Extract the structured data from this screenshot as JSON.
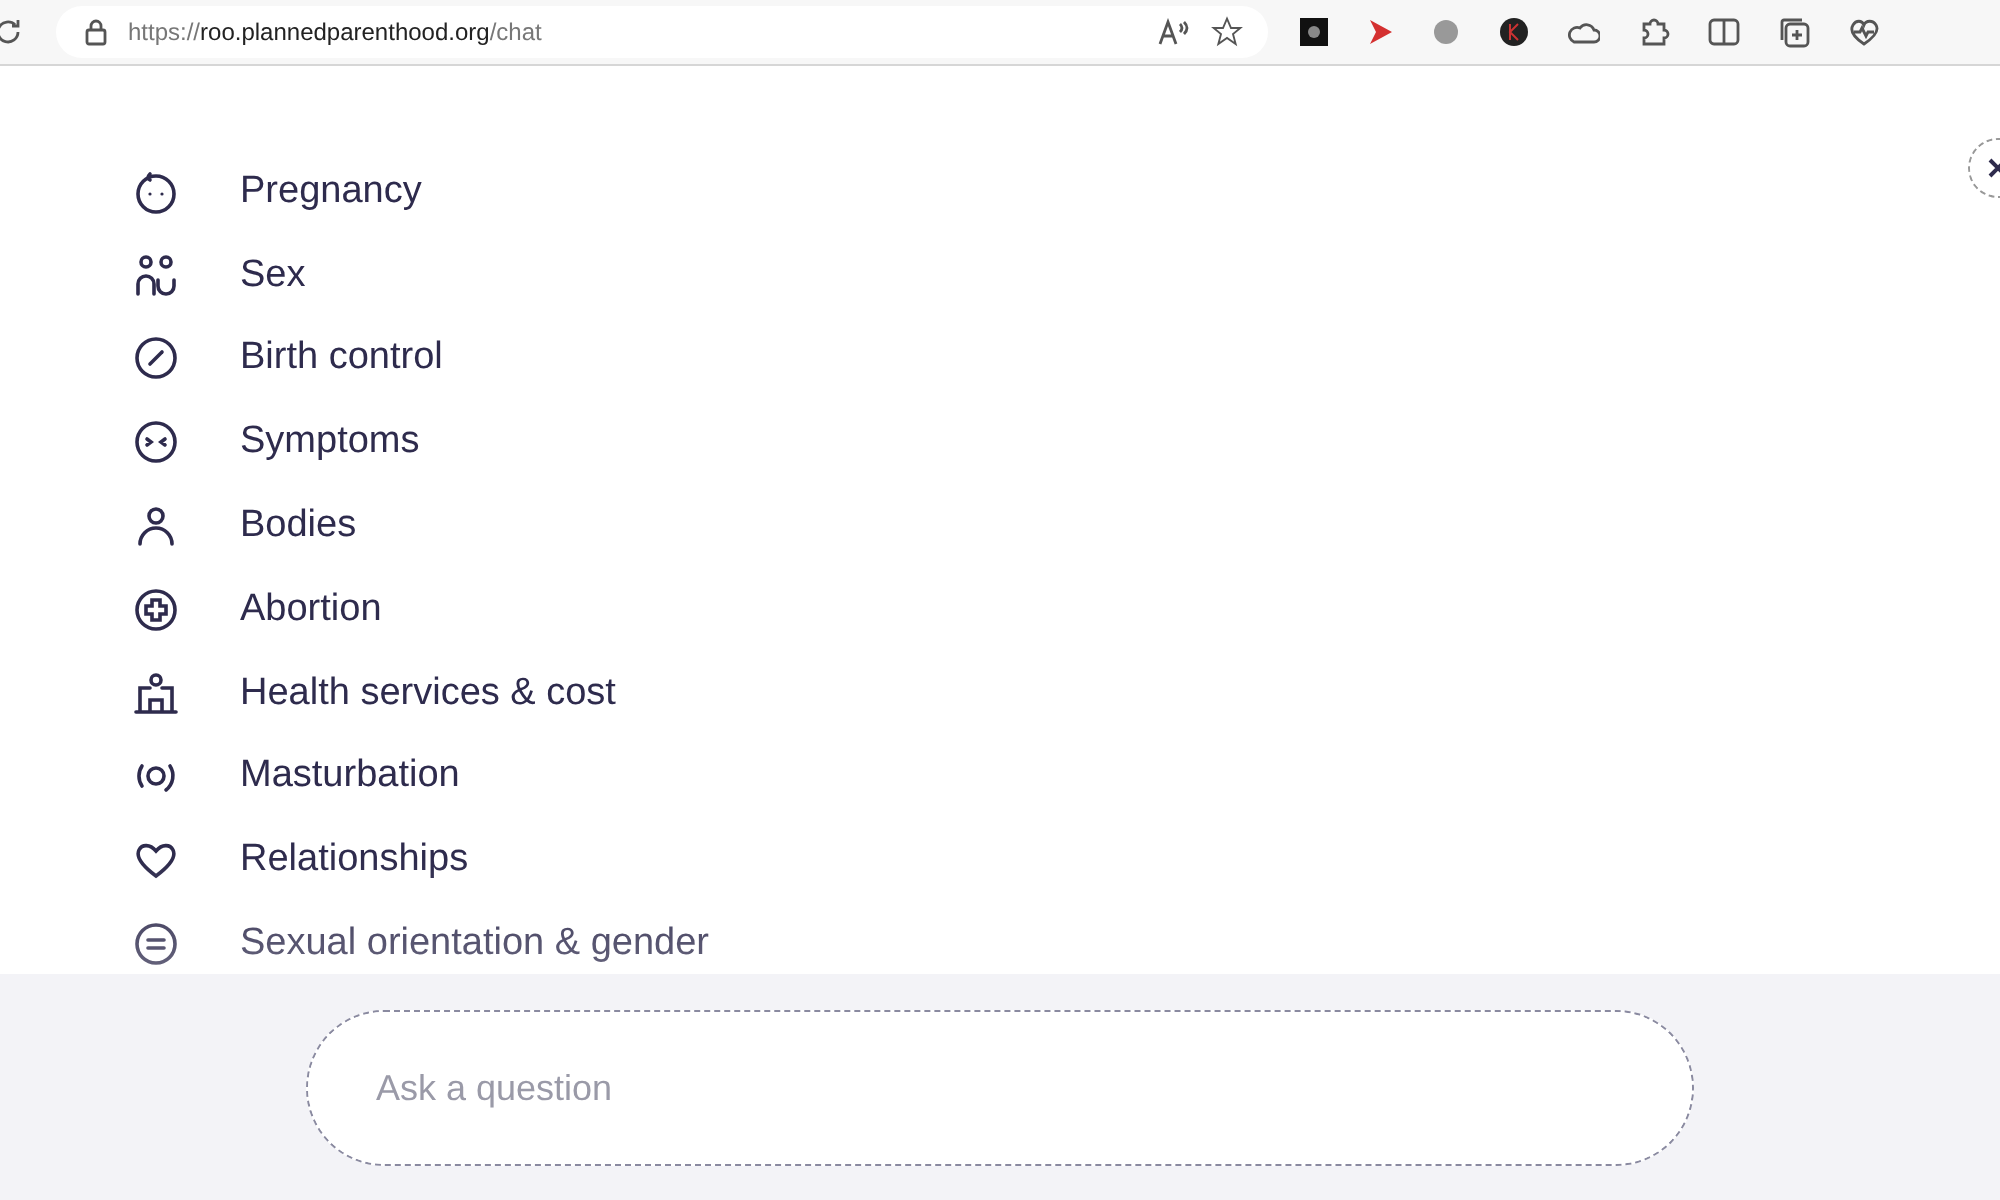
{
  "browser": {
    "url_host": "roo.plannedparenthood.org",
    "url_scheme": "https://",
    "url_path": "/chat"
  },
  "topics": [
    {
      "label": "Pregnancy"
    },
    {
      "label": "Sex"
    },
    {
      "label": "Birth control"
    },
    {
      "label": "Symptoms"
    },
    {
      "label": "Bodies"
    },
    {
      "label": "Abortion"
    },
    {
      "label": "Health services & cost"
    },
    {
      "label": "Masturbation"
    },
    {
      "label": "Relationships"
    },
    {
      "label": "Sexual orientation & gender"
    }
  ],
  "composer": {
    "placeholder": "Ask a question"
  }
}
